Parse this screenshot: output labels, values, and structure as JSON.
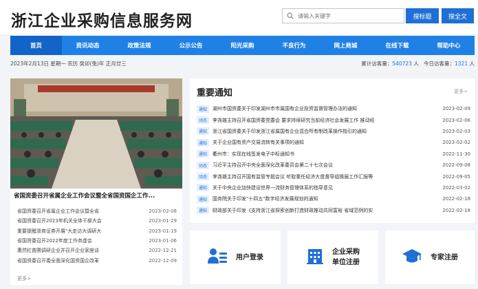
{
  "header": {
    "title": "浙江企业采购信息服务网",
    "search_placeholder": "请输入关键字",
    "search_site_label": "搜标题",
    "search_full_label": "搜全文"
  },
  "nav": {
    "items": [
      "首页",
      "资讯动态",
      "政策法规",
      "公示公告",
      "阳光采购",
      "不良行为",
      "网上商城",
      "在线下载",
      "帮助中心"
    ]
  },
  "infobar": {
    "date": "2023年2月13日 星期一 农历 癸卯(兔)年 正月廿三",
    "visits_label": "累计访客量：",
    "visits_value": "540723",
    "visits_unit": "人",
    "today_label": "今日访客量：",
    "today_value": "1321",
    "today_unit": "人"
  },
  "news": {
    "caption": "省国资委召开省属企业工作会议暨全省国资国企工作...",
    "items": [
      {
        "title": "省国资委召开省属企业工作会议暨全省",
        "date": "2023-02-08"
      },
      {
        "title": "省国资委召开2023年机关全体干部大会",
        "date": "2023-01-29"
      },
      {
        "title": "重要提醒浙商证券开展\"大走访大调研大",
        "date": "2023-01-19"
      },
      {
        "title": "省国资委召开2022年度工作务虚会",
        "date": "2023-01-06"
      },
      {
        "title": "惠然红苗圃调研企业并召开企业家座谈",
        "date": "2022-12-21"
      },
      {
        "title": "省国资委召开委全面深化国资国企改革",
        "date": "2022-12-09"
      }
    ],
    "more": "更多>"
  },
  "notices": {
    "title": "重要通知",
    "more": "更多>",
    "items": [
      {
        "tag": "通知",
        "title": "湖州市国资委关于印发湖州市市属国有企业投资监督管理办法的通知",
        "date": "2023-02-09"
      },
      {
        "tag": "动态",
        "title": "李尧雄主持召开省国资委党委会 要求持续研究当前经济社会发展工作 推动经",
        "date": "2023-02-06"
      },
      {
        "tag": "通知",
        "title": "浙江省国资委关于印发浙江省属国有企业混合所有制改革操作指引的通知",
        "date": "2023-02-03"
      },
      {
        "tag": "通知",
        "title": "关于企业国有资产交易流转有关事项的通知",
        "date": "2023-02-02"
      },
      {
        "tag": "通知",
        "title": "衢州市：实现在线签发电子中标通知书",
        "date": "2022-11-30"
      },
      {
        "tag": "动态",
        "title": "习近平主持召开中央全面深化改革委员会第二十七次会议",
        "date": "2022-09-08"
      },
      {
        "tag": "动态",
        "title": "李尧雄主持召开国有监管专题会议 听取重任经济大盘督导组换届工作汇报等",
        "date": "2022-09-05"
      },
      {
        "tag": "通知",
        "title": "关于中央企业加快建设世界一流财务管理体系的指导意见",
        "date": "2022-03-02"
      },
      {
        "tag": "通知",
        "title": "国务院关于印发\"十四五\"数字经济发展规划的通知",
        "date": "2022-02-18"
      },
      {
        "tag": "通知",
        "title": "财政部关于印发《支持浙江省探索创新打造财政推动共同富裕 省域范例的实",
        "date": "2022-02-18"
      }
    ]
  },
  "cards": {
    "login": "用户登录",
    "register_line1": "企业采购",
    "register_line2": "单位注册",
    "expert": "专家注册"
  },
  "colors": {
    "brand_blue": "#1f80e6",
    "nav_active": "#1264c9",
    "accent": "#1f6fd6"
  }
}
